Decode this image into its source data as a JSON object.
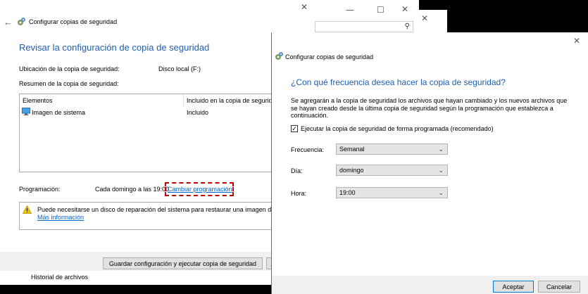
{
  "left": {
    "title": "Configurar copias de seguridad",
    "heading": "Revisar la configuración de copia de seguridad",
    "location_label": "Ubicación de la copia de seguridad:",
    "location_value": "Disco local (F:)",
    "summary_label": "Resumen de la copia de seguridad:",
    "table": {
      "headers": [
        "Elementos",
        "Incluido en la copia de segurid"
      ],
      "rows": [
        {
          "item": "Imagen de sistema",
          "included": "Incluido"
        }
      ]
    },
    "schedule_label": "Programación:",
    "schedule_value": "Cada domingo a las 19:00",
    "schedule_link": "Cambiar programación",
    "warning_text": "Puede necesitarse un disco de reparación del sistema para restaurar una imagen de siste",
    "more_info_link": "Más información",
    "save_button": "Guardar configuración y ejecutar copia de seguridad",
    "file_history": "Historial de archivos"
  },
  "right": {
    "title": "Configurar copias de seguridad",
    "heading": "¿Con qué frecuencia desea hacer la copia de seguridad?",
    "description": "Se agregarán a la copia de seguridad los archivos que hayan cambiado y los nuevos archivos que se hayan creado desde la última copia de seguridad según la programación que establezca a continuación.",
    "checkbox_label": "Ejecutar la copia de seguridad de forma programada (recomendado)",
    "checkbox_checked": true,
    "frequency_label": "Frecuencia:",
    "frequency_value": "Semanal",
    "day_label": "Día:",
    "day_value": "domingo",
    "time_label": "Hora:",
    "time_value": "19:00",
    "ok_button": "Aceptar",
    "cancel_button": "Cancelar"
  },
  "colors": {
    "accent": "#1e5eb0",
    "link": "#0066cc",
    "highlight_border": "#c00000",
    "warning": "#f2c200"
  },
  "icons": [
    "back-arrow-icon",
    "backup-gear-icon",
    "monitor-icon",
    "warning-icon",
    "close-icon",
    "maximize-icon",
    "minimize-icon",
    "search-icon",
    "chevron-down-icon",
    "checkbox-icon"
  ]
}
